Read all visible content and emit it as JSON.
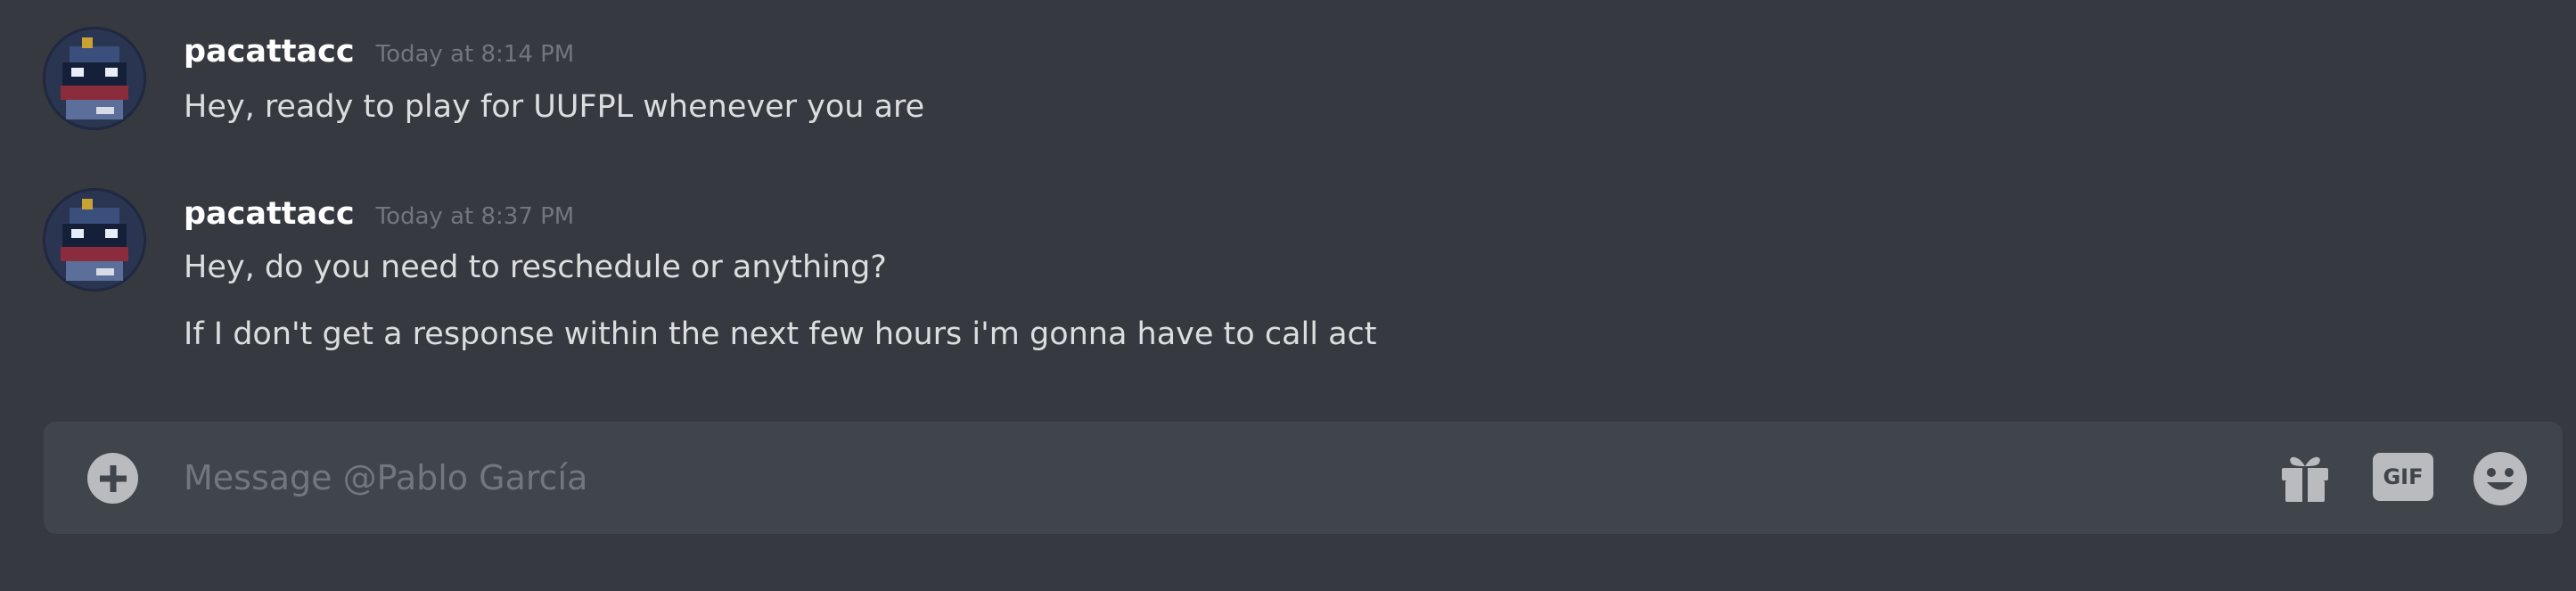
{
  "messages": [
    {
      "username": "pacattacc",
      "timestamp": "Today at 8:14 PM",
      "lines": [
        "Hey, ready to play for UUFPL whenever you are"
      ]
    },
    {
      "username": "pacattacc",
      "timestamp": "Today at 8:37 PM",
      "lines": [
        "Hey, do you need to reschedule or anything?",
        "If I don't get a response within the next few hours i'm gonna have to call act"
      ]
    }
  ],
  "composer": {
    "placeholder": "Message @Pablo García",
    "value": "",
    "gif_label": "GIF"
  },
  "icons": {
    "add": "plus-circle-icon",
    "gift": "gift-icon",
    "gif": "gif-icon",
    "emoji": "emoji-icon"
  },
  "colors": {
    "background": "#36393f",
    "composer": "#40444b",
    "username": "#ffffff",
    "text": "#dcddde",
    "muted": "#72767d",
    "icon": "#b9bbbe"
  }
}
